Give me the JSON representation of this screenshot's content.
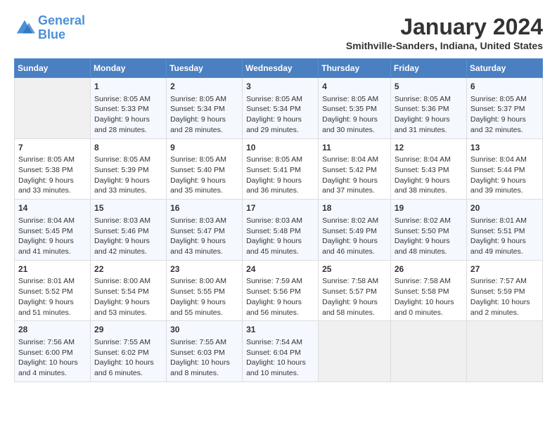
{
  "logo": {
    "text_general": "General",
    "text_blue": "Blue"
  },
  "title": "January 2024",
  "subtitle": "Smithville-Sanders, Indiana, United States",
  "days_of_week": [
    "Sunday",
    "Monday",
    "Tuesday",
    "Wednesday",
    "Thursday",
    "Friday",
    "Saturday"
  ],
  "weeks": [
    [
      {
        "day": "",
        "info": ""
      },
      {
        "day": "1",
        "info": "Sunrise: 8:05 AM\nSunset: 5:33 PM\nDaylight: 9 hours\nand 28 minutes."
      },
      {
        "day": "2",
        "info": "Sunrise: 8:05 AM\nSunset: 5:34 PM\nDaylight: 9 hours\nand 28 minutes."
      },
      {
        "day": "3",
        "info": "Sunrise: 8:05 AM\nSunset: 5:34 PM\nDaylight: 9 hours\nand 29 minutes."
      },
      {
        "day": "4",
        "info": "Sunrise: 8:05 AM\nSunset: 5:35 PM\nDaylight: 9 hours\nand 30 minutes."
      },
      {
        "day": "5",
        "info": "Sunrise: 8:05 AM\nSunset: 5:36 PM\nDaylight: 9 hours\nand 31 minutes."
      },
      {
        "day": "6",
        "info": "Sunrise: 8:05 AM\nSunset: 5:37 PM\nDaylight: 9 hours\nand 32 minutes."
      }
    ],
    [
      {
        "day": "7",
        "info": "Sunrise: 8:05 AM\nSunset: 5:38 PM\nDaylight: 9 hours\nand 33 minutes."
      },
      {
        "day": "8",
        "info": "Sunrise: 8:05 AM\nSunset: 5:39 PM\nDaylight: 9 hours\nand 33 minutes."
      },
      {
        "day": "9",
        "info": "Sunrise: 8:05 AM\nSunset: 5:40 PM\nDaylight: 9 hours\nand 35 minutes."
      },
      {
        "day": "10",
        "info": "Sunrise: 8:05 AM\nSunset: 5:41 PM\nDaylight: 9 hours\nand 36 minutes."
      },
      {
        "day": "11",
        "info": "Sunrise: 8:04 AM\nSunset: 5:42 PM\nDaylight: 9 hours\nand 37 minutes."
      },
      {
        "day": "12",
        "info": "Sunrise: 8:04 AM\nSunset: 5:43 PM\nDaylight: 9 hours\nand 38 minutes."
      },
      {
        "day": "13",
        "info": "Sunrise: 8:04 AM\nSunset: 5:44 PM\nDaylight: 9 hours\nand 39 minutes."
      }
    ],
    [
      {
        "day": "14",
        "info": "Sunrise: 8:04 AM\nSunset: 5:45 PM\nDaylight: 9 hours\nand 41 minutes."
      },
      {
        "day": "15",
        "info": "Sunrise: 8:03 AM\nSunset: 5:46 PM\nDaylight: 9 hours\nand 42 minutes."
      },
      {
        "day": "16",
        "info": "Sunrise: 8:03 AM\nSunset: 5:47 PM\nDaylight: 9 hours\nand 43 minutes."
      },
      {
        "day": "17",
        "info": "Sunrise: 8:03 AM\nSunset: 5:48 PM\nDaylight: 9 hours\nand 45 minutes."
      },
      {
        "day": "18",
        "info": "Sunrise: 8:02 AM\nSunset: 5:49 PM\nDaylight: 9 hours\nand 46 minutes."
      },
      {
        "day": "19",
        "info": "Sunrise: 8:02 AM\nSunset: 5:50 PM\nDaylight: 9 hours\nand 48 minutes."
      },
      {
        "day": "20",
        "info": "Sunrise: 8:01 AM\nSunset: 5:51 PM\nDaylight: 9 hours\nand 49 minutes."
      }
    ],
    [
      {
        "day": "21",
        "info": "Sunrise: 8:01 AM\nSunset: 5:52 PM\nDaylight: 9 hours\nand 51 minutes."
      },
      {
        "day": "22",
        "info": "Sunrise: 8:00 AM\nSunset: 5:54 PM\nDaylight: 9 hours\nand 53 minutes."
      },
      {
        "day": "23",
        "info": "Sunrise: 8:00 AM\nSunset: 5:55 PM\nDaylight: 9 hours\nand 55 minutes."
      },
      {
        "day": "24",
        "info": "Sunrise: 7:59 AM\nSunset: 5:56 PM\nDaylight: 9 hours\nand 56 minutes."
      },
      {
        "day": "25",
        "info": "Sunrise: 7:58 AM\nSunset: 5:57 PM\nDaylight: 9 hours\nand 58 minutes."
      },
      {
        "day": "26",
        "info": "Sunrise: 7:58 AM\nSunset: 5:58 PM\nDaylight: 10 hours\nand 0 minutes."
      },
      {
        "day": "27",
        "info": "Sunrise: 7:57 AM\nSunset: 5:59 PM\nDaylight: 10 hours\nand 2 minutes."
      }
    ],
    [
      {
        "day": "28",
        "info": "Sunrise: 7:56 AM\nSunset: 6:00 PM\nDaylight: 10 hours\nand 4 minutes."
      },
      {
        "day": "29",
        "info": "Sunrise: 7:55 AM\nSunset: 6:02 PM\nDaylight: 10 hours\nand 6 minutes."
      },
      {
        "day": "30",
        "info": "Sunrise: 7:55 AM\nSunset: 6:03 PM\nDaylight: 10 hours\nand 8 minutes."
      },
      {
        "day": "31",
        "info": "Sunrise: 7:54 AM\nSunset: 6:04 PM\nDaylight: 10 hours\nand 10 minutes."
      },
      {
        "day": "",
        "info": ""
      },
      {
        "day": "",
        "info": ""
      },
      {
        "day": "",
        "info": ""
      }
    ]
  ]
}
